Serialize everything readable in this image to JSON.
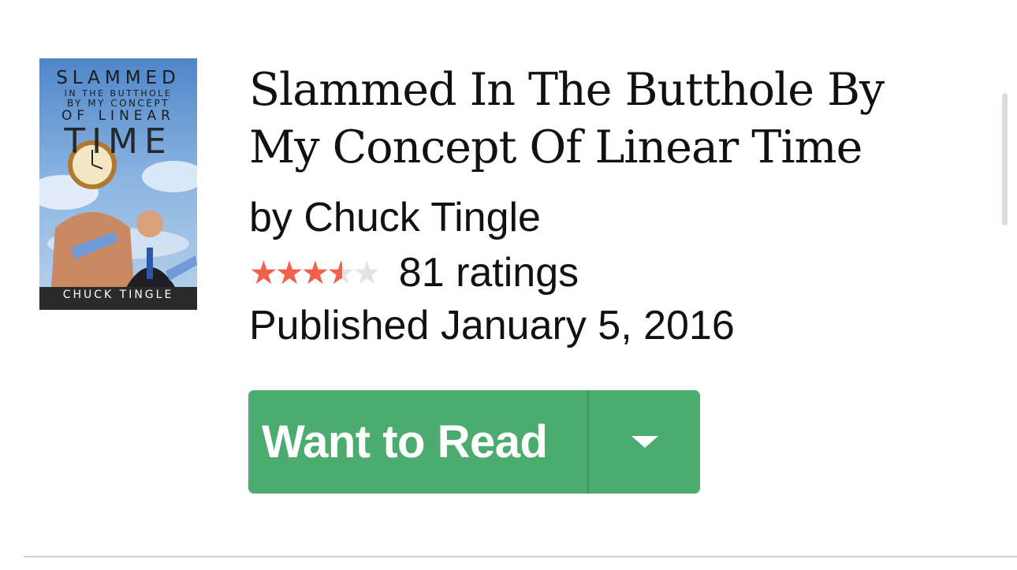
{
  "book": {
    "cover": {
      "line1": "SLAMMED",
      "line2": "IN THE BUTTHOLE",
      "line3": "BY MY CONCEPT",
      "line4": "OF LINEAR",
      "line5": "TIME",
      "author": "CHUCK TINGLE"
    },
    "title": "Slammed In The Butthole By My Concept Of Linear Time",
    "author": "by Chuck Tingle",
    "rating": {
      "stars_filled": 3.6,
      "stars_total": 5,
      "star_color": "#f0604a",
      "empty_star_color": "#e3e3e3",
      "ratings_text": "81 ratings"
    },
    "published": "Published January 5, 2016"
  },
  "actions": {
    "want_to_read_label": "Want to Read",
    "button_color": "#4cab6e"
  }
}
